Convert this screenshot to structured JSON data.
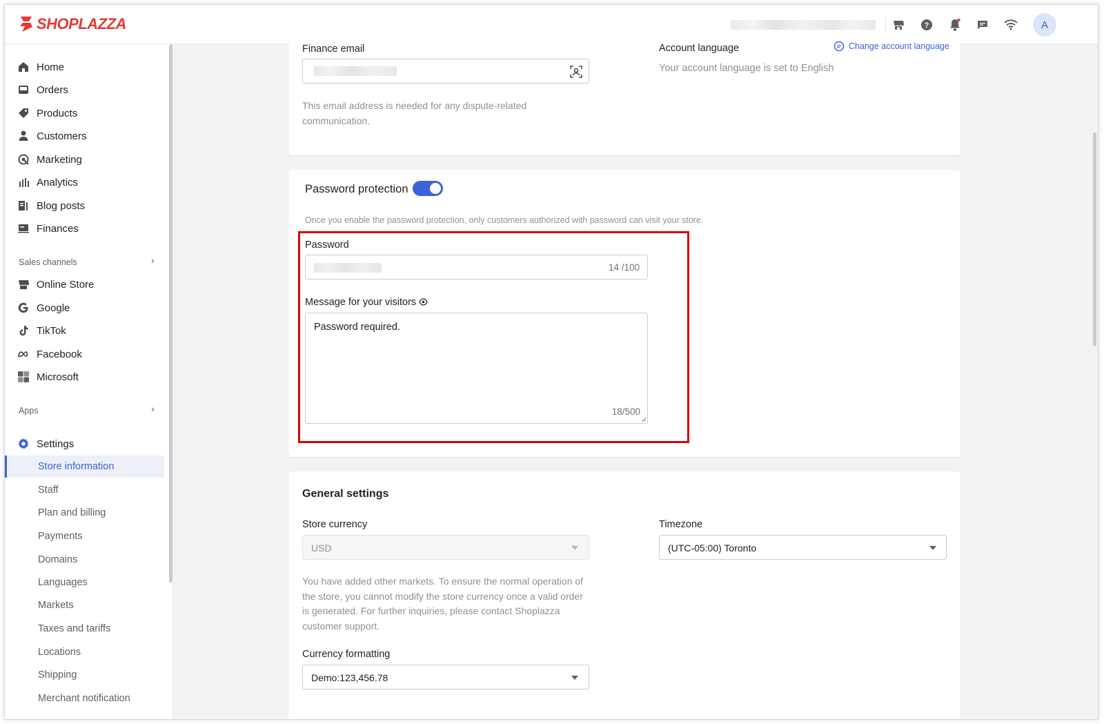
{
  "brand": {
    "name": "SHOPLAZZA",
    "color": "#e53935",
    "accent": "#3c63d9"
  },
  "topbar": {
    "icons": [
      "store-icon",
      "help-icon",
      "bell-icon",
      "chat-icon",
      "wifi-icon"
    ],
    "avatar_initial": "A"
  },
  "sidebar": {
    "items": [
      {
        "label": "Home",
        "icon": "home-icon"
      },
      {
        "label": "Orders",
        "icon": "orders-icon"
      },
      {
        "label": "Products",
        "icon": "tag-icon"
      },
      {
        "label": "Customers",
        "icon": "person-icon"
      },
      {
        "label": "Marketing",
        "icon": "marketing-icon"
      },
      {
        "label": "Analytics",
        "icon": "analytics-icon"
      },
      {
        "label": "Blog posts",
        "icon": "blog-icon"
      },
      {
        "label": "Finances",
        "icon": "finances-icon"
      }
    ],
    "sales_channels_label": "Sales channels",
    "channels": [
      {
        "label": "Online Store",
        "icon": "store-icon"
      },
      {
        "label": "Google",
        "icon": "google-icon"
      },
      {
        "label": "TikTok",
        "icon": "tiktok-icon"
      },
      {
        "label": "Facebook",
        "icon": "meta-icon"
      },
      {
        "label": "Microsoft",
        "icon": "microsoft-icon"
      }
    ],
    "apps_label": "Apps",
    "settings_label": "Settings",
    "settings_items": [
      "Store information",
      "Staff",
      "Plan and billing",
      "Payments",
      "Domains",
      "Languages",
      "Markets",
      "Taxes and tariffs",
      "Locations",
      "Shipping",
      "Merchant notification"
    ]
  },
  "finance": {
    "email_label": "Finance email",
    "email_help": "This email address is needed for any dispute-related communication.",
    "language_label": "Account language",
    "language_link": "Change account language",
    "language_value": "Your account language is set to English"
  },
  "password": {
    "title": "Password protection",
    "enabled": true,
    "description": "Once you enable the password protection, only customers authorized with password can visit your store.",
    "password_label": "Password",
    "password_counter": "14 /100",
    "message_label": "Message for your visitors",
    "message_value": "Password required.",
    "message_counter": "18/500"
  },
  "general": {
    "title": "General settings",
    "currency_label": "Store currency",
    "currency_value": "USD",
    "currency_help": "You have added other markets. To ensure the normal operation of the store, you cannot modify the store currency once a valid order is generated. For further inquiries, please contact Shoplazza customer support.",
    "timezone_label": "Timezone",
    "timezone_value": "(UTC-05:00) Toronto",
    "formatting_label": "Currency formatting",
    "formatting_value": "Demo:123,456.78"
  }
}
